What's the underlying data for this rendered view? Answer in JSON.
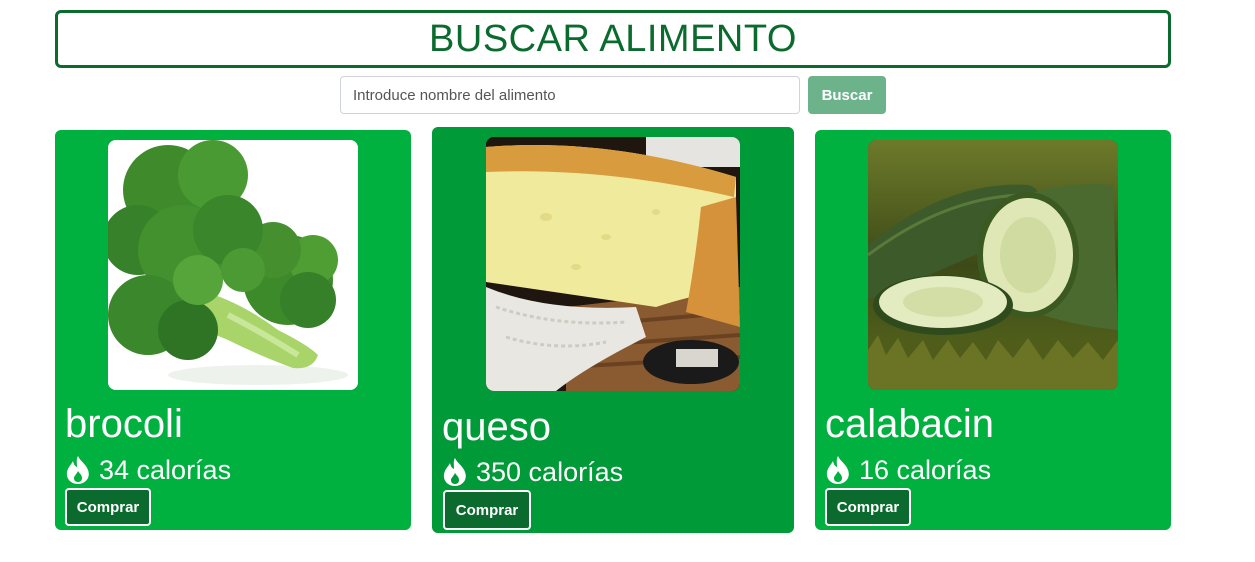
{
  "header": {
    "title": "BUSCAR ALIMENTO"
  },
  "search": {
    "placeholder": "Introduce nombre del alimento",
    "value": "",
    "button_label": "Buscar"
  },
  "foods": [
    {
      "name": "brocoli",
      "calories": "34 calorías",
      "buy_label": "Comprar",
      "image": "broccoli-photo"
    },
    {
      "name": "queso",
      "calories": "350 calorías",
      "buy_label": "Comprar",
      "image": "cheese-photo"
    },
    {
      "name": "calabacin",
      "calories": "16 calorías",
      "buy_label": "Comprar",
      "image": "zucchini-photo"
    }
  ],
  "colors": {
    "title_green": "#0b6b2e",
    "card_green": "#00b140",
    "card_hover_green": "#009a38",
    "button_dark_green": "#0b6b2e",
    "search_button": "#6cb38c"
  },
  "icons": {
    "calories": "fire-icon"
  }
}
